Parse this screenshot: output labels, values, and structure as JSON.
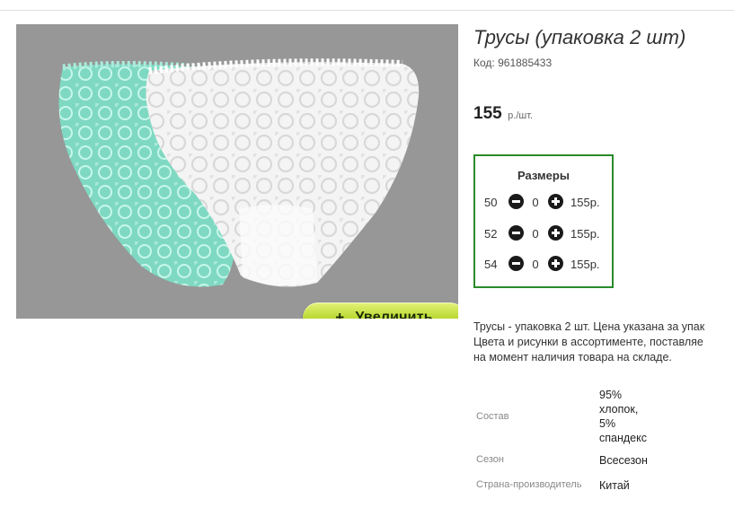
{
  "product": {
    "title": "Трусы (упаковка 2 шт)",
    "code_label": "Код:",
    "code": "961885433",
    "price": "155",
    "price_unit": "р./шт.",
    "zoom_button": {
      "icon": "+",
      "label": "Увеличить"
    }
  },
  "sizes": {
    "title": "Размеры",
    "rows": [
      {
        "size": "50",
        "qty": "0",
        "price": "155р."
      },
      {
        "size": "52",
        "qty": "0",
        "price": "155р."
      },
      {
        "size": "54",
        "qty": "0",
        "price": "155р."
      }
    ]
  },
  "description": [
    "Трусы - упаковка 2 шт. Цена указана за упак",
    "Цвета и рисунки в ассортименте, поставляе",
    "на момент наличия товара на складе."
  ],
  "specs": [
    {
      "label": "Состав",
      "value_lines": [
        "95%",
        "хлопок,",
        "5%",
        "спандекс"
      ]
    },
    {
      "label": "Сезон",
      "value_lines": [
        "Всесезон"
      ]
    },
    {
      "label": "Страна-производитель",
      "value_lines": [
        "Китай"
      ]
    }
  ],
  "colors": {
    "frame_border": "#2a8a2a",
    "zoom_button": "#bfdc3a",
    "photo_background": "#979797",
    "mint": "#7fd9c2",
    "white_lace": "#f4f4f4"
  }
}
